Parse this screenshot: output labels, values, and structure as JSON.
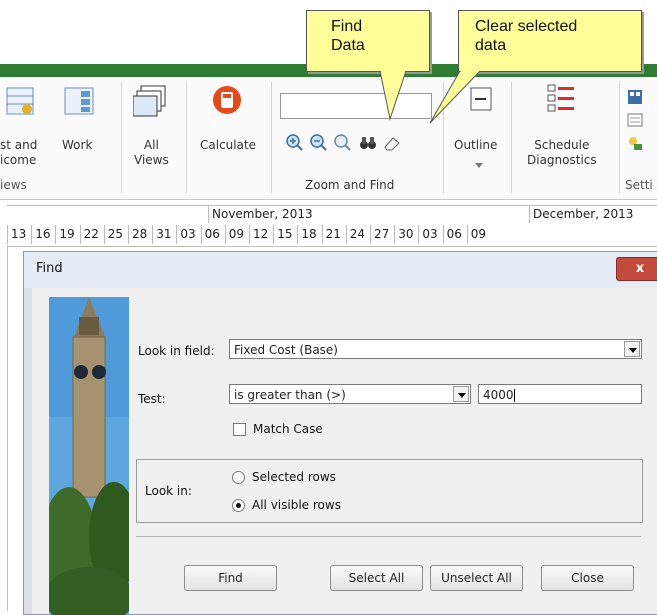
{
  "ribbon": {
    "cost_income_label_1": "st and",
    "cost_income_label_2": "icome",
    "work_label": "Work",
    "views_group_label": "iews",
    "all_views_label_1": "All",
    "all_views_label_2": "Views",
    "calculate_label": "Calculate",
    "zoom_find_group_label": "Zoom and Find",
    "outline_label": "Outline",
    "schedule_diag_label_1": "Schedule",
    "schedule_diag_label_2": "Diagnostics",
    "settings_group_label": "Setti",
    "accent_color": "#2e7d32"
  },
  "callouts": {
    "find_data_1": "Find",
    "find_data_2": "Data",
    "clear_selected_1": "Clear selected",
    "clear_selected_2": "data"
  },
  "timeline": {
    "months": [
      "November, 2013",
      "December, 2013"
    ],
    "days": [
      "13",
      "16",
      "19",
      "22",
      "25",
      "28",
      "31",
      "03",
      "06",
      "09",
      "12",
      "15",
      "18",
      "21",
      "24",
      "27",
      "30",
      "03",
      "06",
      "09"
    ]
  },
  "dialog": {
    "title": "Find",
    "close_glyph": "x",
    "look_in_field_label": "Look in field:",
    "look_in_field_value": "Fixed Cost (Base)",
    "test_label": "Test:",
    "test_value": "is greater than (>)",
    "test_input_value": "4000",
    "match_case_label": "Match Case",
    "look_in_label": "Look in:",
    "selected_rows_label": "Selected rows",
    "all_visible_rows_label": "All visible rows",
    "find_button": "Find",
    "select_all_button": "Select All",
    "unselect_all_button": "Unselect All",
    "close_button": "Close"
  }
}
